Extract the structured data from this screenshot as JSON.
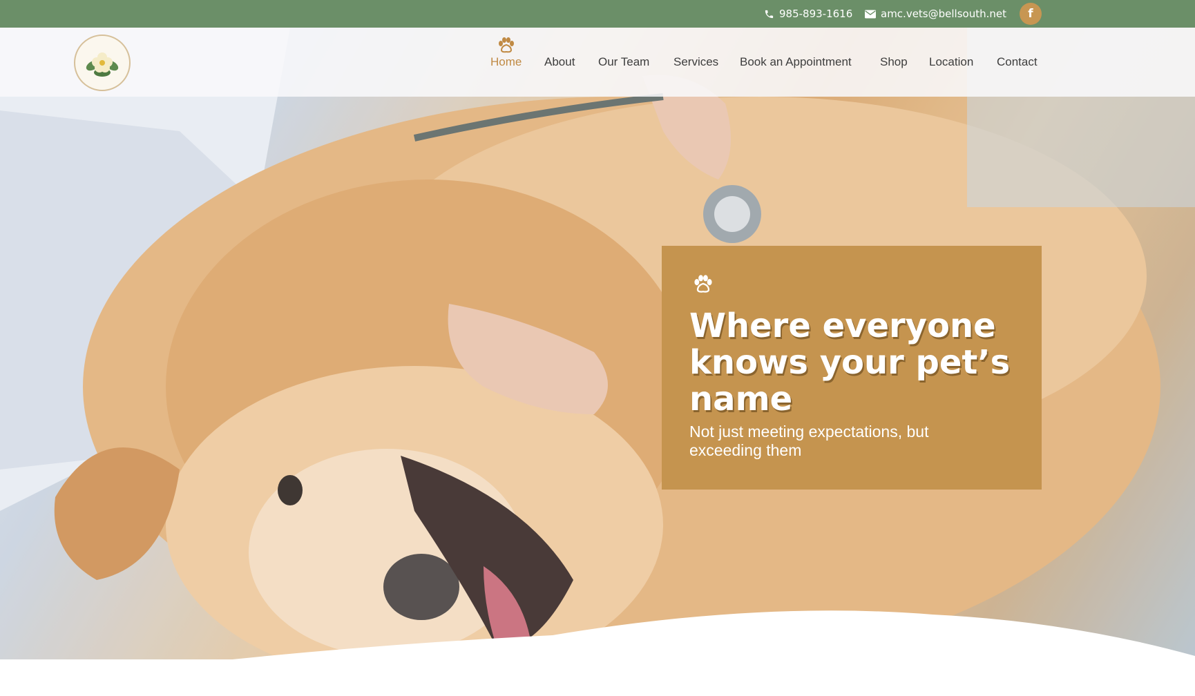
{
  "topbar": {
    "phone": "985-893-1616",
    "email": "amc.vets@bellsouth.net",
    "facebook_icon": "facebook-icon",
    "facebook_letter": "f",
    "bg_color": "#6b8f68",
    "accent_color": "#c79652"
  },
  "header": {
    "logo_icon": "clinic-flower-logo",
    "nav": [
      {
        "label": "Home",
        "active": true
      },
      {
        "label": "About"
      },
      {
        "label": "Our Team"
      },
      {
        "label": "Services"
      },
      {
        "label": "Book an Appointment"
      },
      {
        "label": "Shop"
      },
      {
        "label": "Location"
      },
      {
        "label": "Contact"
      }
    ],
    "active_color": "#c08a44"
  },
  "hero": {
    "background_icon": "golden-retriever-vet-exam-photo",
    "callout": {
      "icon": "paw-icon",
      "title": "Where everyone knows your pet’s name",
      "subtitle": "Not just meeting expectations, but exceeding them",
      "bg_color": "#c5944f"
    }
  }
}
